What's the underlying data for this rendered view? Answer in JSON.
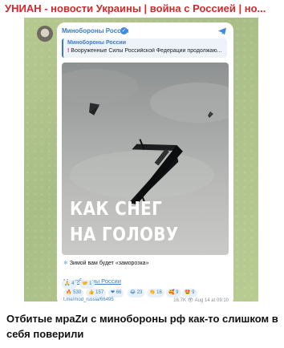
{
  "header": {
    "channel_title": "УНИАН - новости Украины | война с Россией | но..."
  },
  "message": {
    "sender": "Минобороны России",
    "reply": {
      "author": "Минобороны России",
      "text": "Вооруженные Силы Российской Федерации продолжаю..."
    },
    "media_text": {
      "line1": "КАК СНЕГ",
      "line2": "НА ГОЛОВУ"
    },
    "caption": "Зимой вам будет «заморозка»",
    "channel_link": "Минобороны России",
    "reactions": [
      {
        "emoji": "🔥",
        "count": "530"
      },
      {
        "emoji": "👍",
        "count": "157"
      },
      {
        "emoji": "❤",
        "count": "66"
      },
      {
        "emoji": "😂",
        "count": "23"
      },
      {
        "emoji": "👏",
        "count": "16"
      },
      {
        "emoji": "🥰",
        "count": "9"
      },
      {
        "emoji": "🤩",
        "count": "9"
      },
      {
        "emoji": "🙏",
        "count": "4"
      },
      {
        "emoji": "🤝",
        "count": "1"
      }
    ],
    "footer_link": "t.me/mod_russia/66495",
    "views": "16.7K",
    "date": "Aug 14 at 09:10"
  },
  "post_text": "Отбитые мраZи с минобороны рф как-то слишком в себя поверили",
  "colors": {
    "headline": "#d4282b",
    "link": "#3a7cc1",
    "chat_bg": "#b0c48c"
  }
}
